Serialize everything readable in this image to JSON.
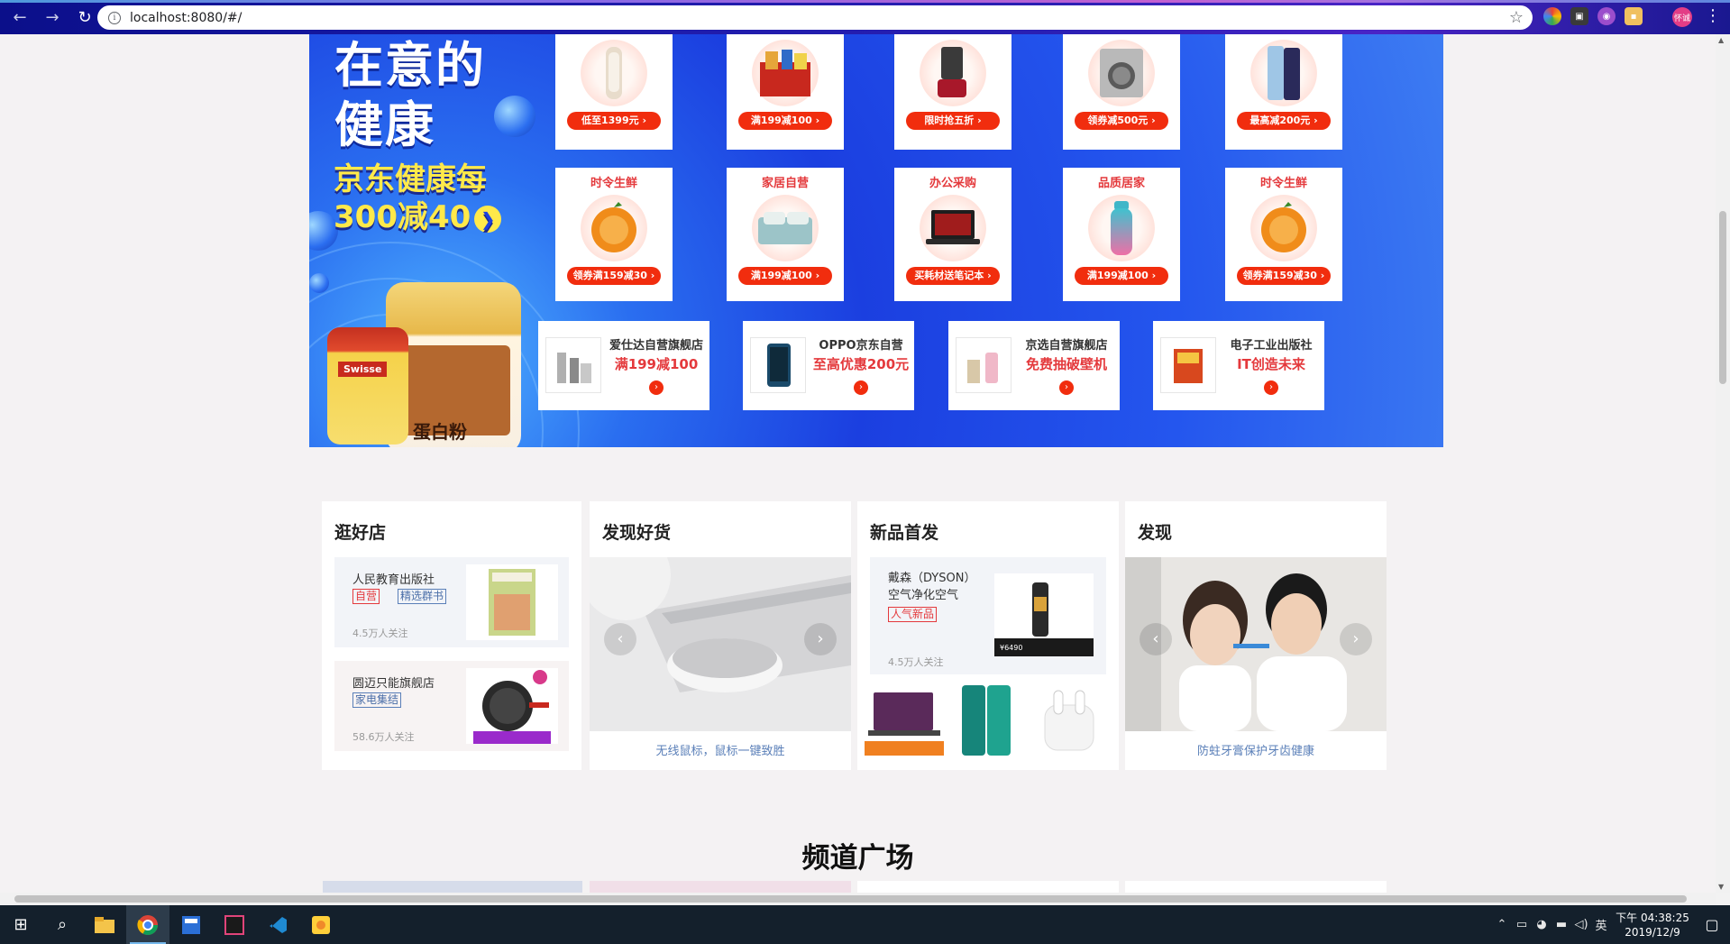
{
  "browser": {
    "url": "localhost:8080/#/",
    "back_icon": "←",
    "forward_icon": "→",
    "reload_icon": "↻",
    "star_icon": "☆",
    "info_icon": "i",
    "profile_label": "怀诚",
    "menu_icon": "⋮"
  },
  "banner": {
    "title_line1": "在意的",
    "title_line2": "健康",
    "promo_line1": "京东健康每",
    "promo_line2": "300减40",
    "promo_arrow": "❯",
    "can_label": "蛋白粉",
    "bottle_brand": "Swisse",
    "row1": [
      {
        "pill": "低至1399元 ›"
      },
      {
        "pill": "满199减100 ›"
      },
      {
        "pill": "限时抢五折 ›"
      },
      {
        "pill": "领券减500元 ›"
      },
      {
        "pill": "最高减200元 ›"
      }
    ],
    "row2": [
      {
        "category": "时令生鲜",
        "pill": "领券满159减30 ›"
      },
      {
        "category": "家居自营",
        "pill": "满199减100 ›"
      },
      {
        "category": "办公采购",
        "pill": "买耗材送笔记本 ›"
      },
      {
        "category": "品质居家",
        "pill": "满199减100 ›"
      },
      {
        "category": "时令生鲜",
        "pill": "领券满159减30 ›"
      }
    ],
    "stores": [
      {
        "name": "爱仕达自营旗舰店",
        "offer": "满199减100",
        "go": "›"
      },
      {
        "name": "OPPO京东自营",
        "offer": "至高优惠200元",
        "go": "›"
      },
      {
        "name": "京选自营旗舰店",
        "offer": "免费抽破壁机",
        "go": "›"
      },
      {
        "name": "电子工业出版社",
        "offer": "IT创造未来",
        "go": "›"
      }
    ]
  },
  "sections": {
    "good_shops": {
      "title": "逛好店",
      "shops": [
        {
          "name": "人民教育出版社",
          "tag1": "自营",
          "tag2": "精选群书",
          "followers": "4.5万人关注"
        },
        {
          "name": "圆迈只能旗舰店",
          "tag1": "家电集结",
          "followers": "58.6万人关注"
        }
      ]
    },
    "discover_goods": {
      "title": "发现好货",
      "caption": "无线鼠标，鼠标一键致胜",
      "prev": "‹",
      "next": "›"
    },
    "new_release": {
      "title": "新品首发",
      "product_name_line1": "戴森（DYSON）",
      "product_name_line2": "空气净化空气",
      "tag": "人气新品",
      "followers": "4.5万人关注",
      "price_badge": "¥6490"
    },
    "discover": {
      "title": "发现",
      "caption": "防蛀牙膏保护牙齿健康",
      "prev": "‹",
      "next": "›"
    }
  },
  "channel": {
    "title": "频道广场"
  },
  "taskbar": {
    "start_icon": "⊞",
    "search_icon": "⌕",
    "time": "04:38:25",
    "ampm": "下午",
    "date": "2019/12/9",
    "ime": "英"
  }
}
